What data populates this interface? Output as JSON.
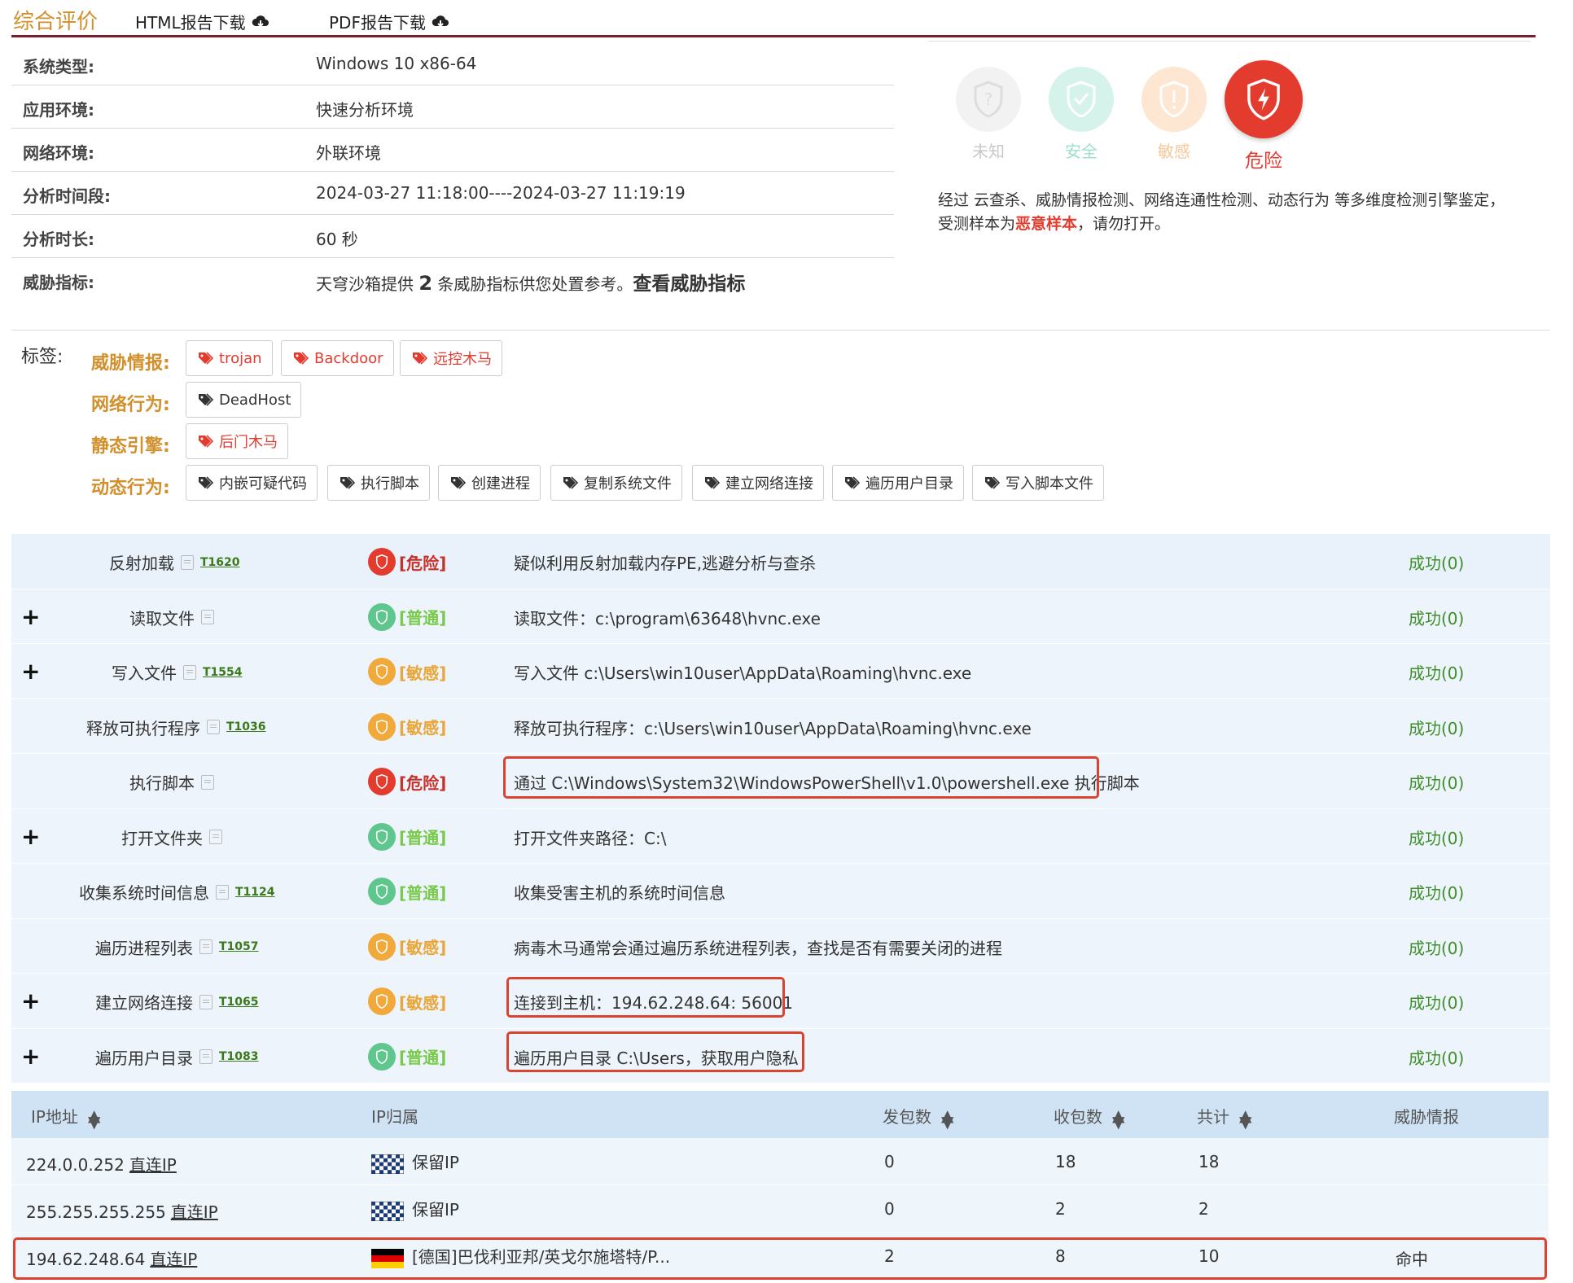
{
  "header": {
    "title": "综合评价",
    "html_download": "HTML报告下载",
    "pdf_download": "PDF报告下载"
  },
  "info": {
    "rows": [
      {
        "label": "系统类型:",
        "value": "Windows 10 x86-64"
      },
      {
        "label": "应用环境:",
        "value": "快速分析环境"
      },
      {
        "label": "网络环境:",
        "value": "外联环境"
      },
      {
        "label": "分析时间段:",
        "value": "2024-03-27 11:18:00----2024-03-27 11:19:19"
      },
      {
        "label": "分析时长:",
        "value": "60 秒"
      }
    ],
    "threat_label": "威胁指标:",
    "threat_prefix": "天穹沙箱提供",
    "threat_count": "2",
    "threat_suffix": "条威胁指标供您处置参考。",
    "threat_link": "查看威胁指标"
  },
  "verdict": {
    "levels": [
      {
        "label": "未知",
        "color": "#c8c8c8"
      },
      {
        "label": "安全",
        "color": "#7fd8bd"
      },
      {
        "label": "敏感",
        "color": "#f6c79a"
      },
      {
        "label": "危险",
        "color": "#e43b2f"
      }
    ],
    "text_prefix": "经过 云查杀、威胁情报检测、网络连通性检测、动态行为 等多维度检测引擎鉴定，受测样本为",
    "malicious": "恶意样本",
    "text_suffix": "，请勿打开。"
  },
  "tags": {
    "title": "标签:",
    "categories": [
      {
        "name": "威胁情报:",
        "tags": [
          "trojan",
          "Backdoor",
          "远控木马"
        ],
        "color": "red"
      },
      {
        "name": "网络行为:",
        "tags": [
          "DeadHost"
        ],
        "color": "blk"
      },
      {
        "name": "静态引擎:",
        "tags": [
          "后门木马"
        ],
        "color": "red"
      },
      {
        "name": "动态行为:",
        "tags": [
          "内嵌可疑代码",
          "执行脚本",
          "创建进程",
          "复制系统文件",
          "建立网络连接",
          "遍历用户目录",
          "写入脚本文件"
        ],
        "color": "blk"
      }
    ]
  },
  "behaviors": [
    {
      "name": "反射加载",
      "tid": "T1620",
      "level": "[危险]",
      "desc": "疑似利用反射加载内存PE,逃避分析与查杀",
      "result": "成功(0)",
      "plus": false
    },
    {
      "name": "读取文件",
      "tid": "",
      "level": "[普通]",
      "desc": "读取文件：c:\\program\\63648\\hvnc.exe",
      "result": "成功(0)",
      "plus": true
    },
    {
      "name": "写入文件",
      "tid": "T1554",
      "level": "[敏感]",
      "desc": "写入文件 c:\\Users\\win10user\\AppData\\Roaming\\hvnc.exe",
      "result": "成功(0)",
      "plus": true
    },
    {
      "name": "释放可执行程序",
      "tid": "T1036",
      "level": "[敏感]",
      "desc": "释放可执行程序：c:\\Users\\win10user\\AppData\\Roaming\\hvnc.exe",
      "result": "成功(0)",
      "plus": false
    },
    {
      "name": "执行脚本",
      "tid": "",
      "level": "[危险]",
      "desc": "通过 C:\\Windows\\System32\\WindowsPowerShell\\v1.0\\powershell.exe 执行脚本",
      "result": "成功(0)",
      "plus": false
    },
    {
      "name": "打开文件夹",
      "tid": "",
      "level": "[普通]",
      "desc": "打开文件夹路径：C:\\",
      "result": "成功(0)",
      "plus": true
    },
    {
      "name": "收集系统时间信息",
      "tid": "T1124",
      "level": "[普通]",
      "desc": "收集受害主机的系统时间信息",
      "result": "成功(0)",
      "plus": false
    },
    {
      "name": "遍历进程列表",
      "tid": "T1057",
      "level": "[敏感]",
      "desc": "病毒木马通常会通过遍历系统进程列表，查找是否有需要关闭的进程",
      "result": "成功(0)",
      "plus": false
    },
    {
      "name": "建立网络连接",
      "tid": "T1065",
      "level": "[敏感]",
      "desc": "连接到主机：194.62.248.64: 56001",
      "result": "成功(0)",
      "plus": true
    },
    {
      "name": "遍历用户目录",
      "tid": "T1083",
      "level": "[普通]",
      "desc": "遍历用户目录 C:\\Users，获取用户隐私",
      "result": "成功(0)",
      "plus": true
    }
  ],
  "ip_table": {
    "headers": [
      "IP地址",
      "IP归属",
      "发包数",
      "收包数",
      "共计",
      "威胁情报"
    ],
    "direct_label": "直连IP",
    "rows": [
      {
        "ip": "224.0.0.252",
        "owner": "保留IP",
        "sent": "0",
        "recv": "18",
        "total": "18",
        "intel": "",
        "flag": "reserved"
      },
      {
        "ip": "255.255.255.255",
        "owner": "保留IP",
        "sent": "0",
        "recv": "2",
        "total": "2",
        "intel": "",
        "flag": "reserved"
      },
      {
        "ip": "194.62.248.64",
        "owner": "[德国]巴伐利亚邦/英戈尔施塔特/P...",
        "sent": "2",
        "recv": "8",
        "total": "10",
        "intel": "命中",
        "flag": "germany"
      }
    ]
  }
}
